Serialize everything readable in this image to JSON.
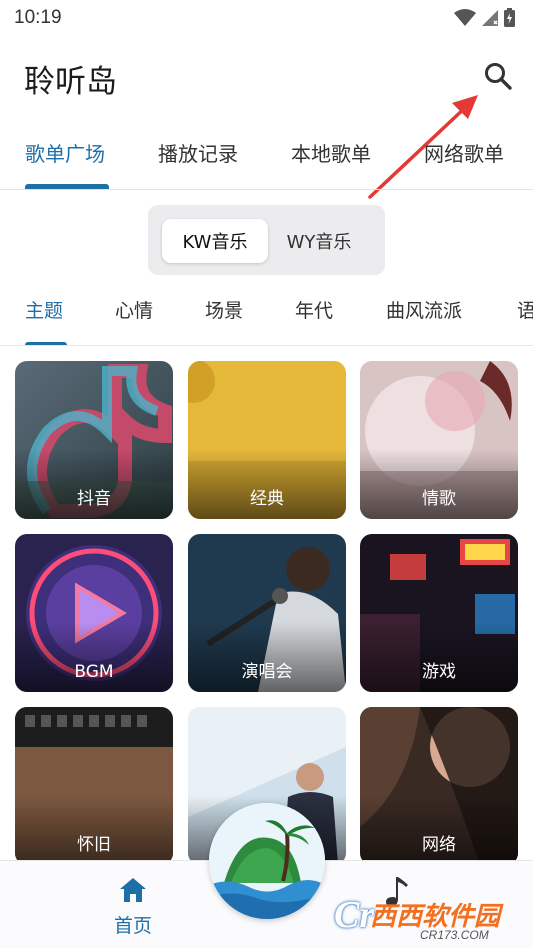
{
  "status_bar": {
    "time": "10:19"
  },
  "app": {
    "title": "聆听岛"
  },
  "main_tabs": [
    {
      "label": "歌单广场",
      "active": true
    },
    {
      "label": "播放记录",
      "active": false
    },
    {
      "label": "本地歌单",
      "active": false
    },
    {
      "label": "网络歌单",
      "active": false
    }
  ],
  "sources": [
    {
      "label": "KW音乐",
      "active": true
    },
    {
      "label": "WY音乐",
      "active": false
    }
  ],
  "category_tabs": [
    {
      "label": "主题",
      "active": true
    },
    {
      "label": "心情",
      "active": false
    },
    {
      "label": "场景",
      "active": false
    },
    {
      "label": "年代",
      "active": false
    },
    {
      "label": "曲风流派",
      "active": false
    },
    {
      "label": "语",
      "active": false
    }
  ],
  "cards": [
    {
      "label": "抖音"
    },
    {
      "label": "经典"
    },
    {
      "label": "情歌"
    },
    {
      "label": "BGM"
    },
    {
      "label": "演唱会"
    },
    {
      "label": "游戏"
    },
    {
      "label": "怀旧"
    },
    {
      "label": ""
    },
    {
      "label": "网络"
    }
  ],
  "bottom_nav": {
    "home_label": "首页"
  },
  "watermark": {
    "main": "西西软件园",
    "sub": "CR173.COM",
    "logo": "Cr"
  },
  "colors": {
    "accent": "#1d6fa8",
    "annotation": "#e53935"
  },
  "icons": {
    "search": "search-icon",
    "home": "home-icon",
    "music": "music-note-icon"
  }
}
